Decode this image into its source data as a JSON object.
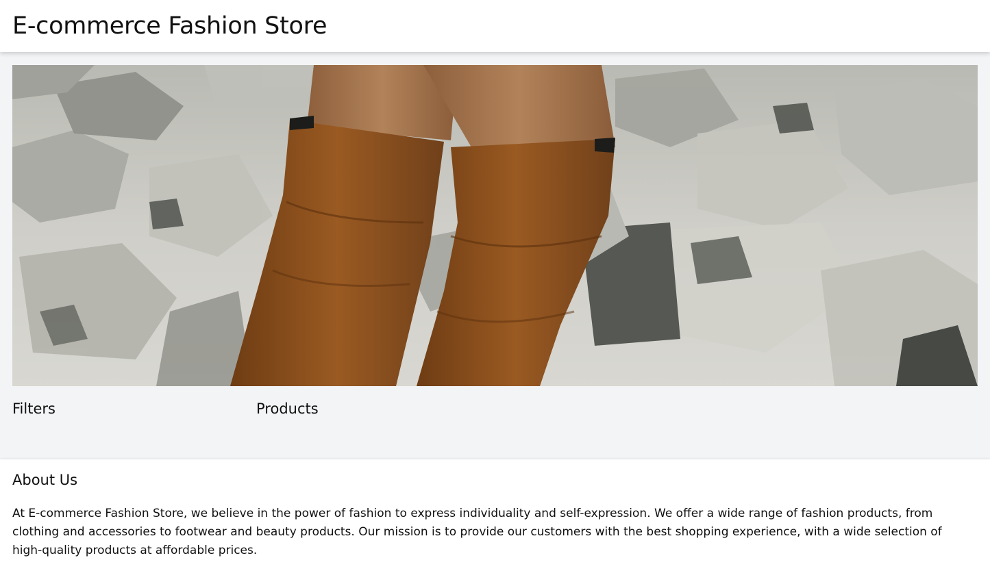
{
  "header": {
    "title": "E-commerce Fashion Store"
  },
  "hero": {
    "image_subject": "boots-on-rocks",
    "colors": {
      "rock": "#c9c8c2",
      "rock_dark": "#6e6e68",
      "boot": "#8a4f1c",
      "skin": "#a7774f"
    }
  },
  "main": {
    "filters_heading": "Filters",
    "products_heading": "Products"
  },
  "footer": {
    "about_heading": "About Us",
    "about_text": "At E-commerce Fashion Store, we believe in the power of fashion to express individuality and self-expression. We offer a wide range of fashion products, from clothing and accessories to footwear and beauty products. Our mission is to provide our customers with the best shopping experience, with a wide selection of high-quality products at affordable prices."
  },
  "theme": {
    "page_background": "#f3f4f6",
    "surface": "#ffffff",
    "text": "#111111"
  }
}
